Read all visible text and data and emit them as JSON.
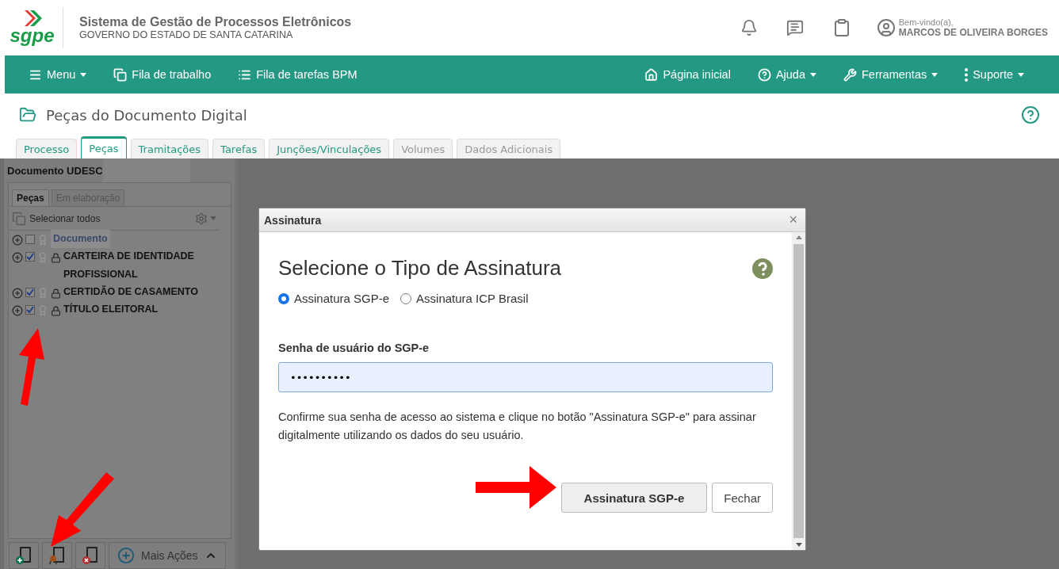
{
  "header": {
    "logo": "sgpe",
    "title": "Sistema de Gestão de Processos Eletrônicos",
    "subtitle": "GOVERNO DO ESTADO DE SANTA CATARINA",
    "welcome": "Bem-vindo(a),",
    "user_name": "MARCOS DE OLIVEIRA BORGES"
  },
  "nav": {
    "left": [
      {
        "label": "Menu",
        "caret": true
      },
      {
        "label": "Fila de trabalho",
        "caret": false
      },
      {
        "label": "Fila de tarefas BPM",
        "caret": false
      }
    ],
    "right": [
      {
        "label": "Página inicial",
        "caret": false
      },
      {
        "label": "Ajuda",
        "caret": true
      },
      {
        "label": "Ferramentas",
        "caret": true
      },
      {
        "label": "Suporte",
        "caret": true
      }
    ]
  },
  "page_title": "Peças do Documento Digital",
  "tabs": [
    {
      "label": "Processo",
      "selected": false,
      "disabled": false
    },
    {
      "label": "Peças",
      "selected": true,
      "disabled": false
    },
    {
      "label": "Tramitações",
      "selected": false,
      "disabled": false
    },
    {
      "label": "Tarefas",
      "selected": false,
      "disabled": false
    },
    {
      "label": "Junções/Vinculações",
      "selected": false,
      "disabled": false
    },
    {
      "label": "Volumes",
      "selected": false,
      "disabled": true
    },
    {
      "label": "Dados Adicionais",
      "selected": false,
      "disabled": true
    }
  ],
  "left_panel": {
    "title": "Documento UDESC",
    "tabs": [
      {
        "label": "Peças",
        "selected": true
      },
      {
        "label": "Em elaboração",
        "selected": false
      }
    ],
    "select_all": "Selecionar todos",
    "items": [
      {
        "label": "Documento",
        "checked": false,
        "locked": false,
        "selected": true
      },
      {
        "label": "CARTEIRA DE IDENTIDADE PROFISSIONAL",
        "checked": true,
        "locked": true,
        "selected": false
      },
      {
        "label": "CERTIDÃO DE CASAMENTO",
        "checked": true,
        "locked": true,
        "selected": false
      },
      {
        "label": "TÍTULO ELEITORAL",
        "checked": true,
        "locked": true,
        "selected": false
      }
    ],
    "more_actions": "Mais Ações"
  },
  "dialog": {
    "title": "Assinatura",
    "close": "×",
    "heading": "Selecione o Tipo de Assinatura",
    "options": [
      {
        "label": "Assinatura SGP-e",
        "selected": true
      },
      {
        "label": "Assinatura ICP Brasil",
        "selected": false
      }
    ],
    "field_label": "Senha de usuário do SGP-e",
    "password": "••••••••••",
    "help": "Confirme sua senha de acesso ao sistema e clique no botão \"Assinatura SGP-e\" para assinar digitalmente utilizando os dados do seu usuário.",
    "buttons": [
      {
        "label": "Assinatura SGP-e",
        "kind": "primary"
      },
      {
        "label": "Fechar",
        "kind": "secondary"
      }
    ]
  }
}
